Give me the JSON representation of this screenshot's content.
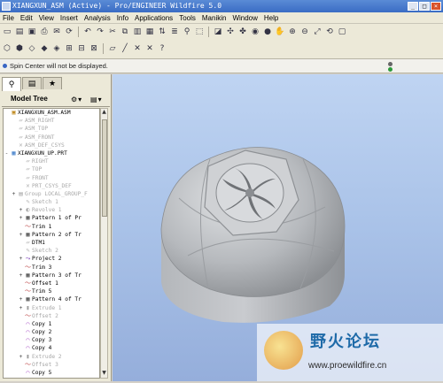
{
  "window": {
    "title": "XIANGXUN_ASM (Active) - Pro/ENGINEER Wildfire 5.0"
  },
  "menu": [
    "File",
    "Edit",
    "View",
    "Insert",
    "Analysis",
    "Info",
    "Applications",
    "Tools",
    "Manikin",
    "Window",
    "Help"
  ],
  "message": "Spin Center will not be displayed.",
  "model_tree": {
    "title": "Model Tree",
    "rows": [
      {
        "label": "XIANGXUN_ASM.ASM",
        "indent": 0,
        "exp": "",
        "icon": "asm",
        "sup": false
      },
      {
        "label": "ASM_RIGHT",
        "indent": 1,
        "exp": "",
        "icon": "plane",
        "sup": true
      },
      {
        "label": "ASM_TOP",
        "indent": 1,
        "exp": "",
        "icon": "plane",
        "sup": true
      },
      {
        "label": "ASM_FRONT",
        "indent": 1,
        "exp": "",
        "icon": "plane",
        "sup": true
      },
      {
        "label": "ASM_DEF_CSYS",
        "indent": 1,
        "exp": "",
        "icon": "csys",
        "sup": true
      },
      {
        "label": "XIANGXUN_UP.PRT",
        "indent": 0,
        "exp": "-",
        "icon": "part",
        "sup": false
      },
      {
        "label": "RIGHT",
        "indent": 2,
        "exp": "",
        "icon": "plane",
        "sup": true
      },
      {
        "label": "TOP",
        "indent": 2,
        "exp": "",
        "icon": "plane",
        "sup": true
      },
      {
        "label": "FRONT",
        "indent": 2,
        "exp": "",
        "icon": "plane",
        "sup": true
      },
      {
        "label": "PRT_CSYS_DEF",
        "indent": 2,
        "exp": "",
        "icon": "csys",
        "sup": true
      },
      {
        "label": "Group LOCAL_GROUP_F",
        "indent": 1,
        "exp": "+",
        "icon": "group",
        "sup": true
      },
      {
        "label": "Sketch 1",
        "indent": 2,
        "exp": "",
        "icon": "sketch",
        "sup": true
      },
      {
        "label": "Revolve 1",
        "indent": 2,
        "exp": "+",
        "icon": "revolve",
        "sup": true
      },
      {
        "label": "Pattern 1 of Pr",
        "indent": 2,
        "exp": "+",
        "icon": "pattern",
        "sup": false
      },
      {
        "label": "Trim 1",
        "indent": 2,
        "exp": "",
        "icon": "trim",
        "sup": false
      },
      {
        "label": "Pattern 2 of Tr",
        "indent": 2,
        "exp": "+",
        "icon": "pattern",
        "sup": false
      },
      {
        "label": "DTM1",
        "indent": 2,
        "exp": "",
        "icon": "plane",
        "sup": false
      },
      {
        "label": "Sketch 2",
        "indent": 2,
        "exp": "",
        "icon": "sketch",
        "sup": true
      },
      {
        "label": "Project 2",
        "indent": 2,
        "exp": "+",
        "icon": "project",
        "sup": false
      },
      {
        "label": "Trim 3",
        "indent": 2,
        "exp": "",
        "icon": "trim",
        "sup": false
      },
      {
        "label": "Pattern 3 of Tr",
        "indent": 2,
        "exp": "+",
        "icon": "pattern",
        "sup": false
      },
      {
        "label": "Offset 1",
        "indent": 2,
        "exp": "",
        "icon": "trim",
        "sup": false
      },
      {
        "label": "Trim 5",
        "indent": 2,
        "exp": "",
        "icon": "trim",
        "sup": false
      },
      {
        "label": "Pattern 4 of Tr",
        "indent": 2,
        "exp": "+",
        "icon": "pattern",
        "sup": false
      },
      {
        "label": "Extrude 1",
        "indent": 2,
        "exp": "+",
        "icon": "extrude",
        "sup": true
      },
      {
        "label": "Offset 2",
        "indent": 2,
        "exp": "",
        "icon": "trim",
        "sup": true
      },
      {
        "label": "Copy 1",
        "indent": 2,
        "exp": "",
        "icon": "copy",
        "sup": false
      },
      {
        "label": "Copy 2",
        "indent": 2,
        "exp": "",
        "icon": "copy",
        "sup": false
      },
      {
        "label": "Copy 3",
        "indent": 2,
        "exp": "",
        "icon": "copy",
        "sup": false
      },
      {
        "label": "Copy 4",
        "indent": 2,
        "exp": "",
        "icon": "copy",
        "sup": false
      },
      {
        "label": "Extrude 2",
        "indent": 2,
        "exp": "+",
        "icon": "extrude",
        "sup": true
      },
      {
        "label": "Offset 3",
        "indent": 2,
        "exp": "",
        "icon": "trim",
        "sup": true
      },
      {
        "label": "Copy 5",
        "indent": 2,
        "exp": "",
        "icon": "copy",
        "sup": false
      }
    ]
  },
  "watermark": {
    "brand": "野火论坛",
    "url": "www.proewildfire.cn"
  },
  "colors": {
    "viewport_top": "#bfd4f2",
    "viewport_bottom": "#95aedb",
    "title_bar": "#3a6cc4",
    "model_surface": "#b9bcc0"
  }
}
